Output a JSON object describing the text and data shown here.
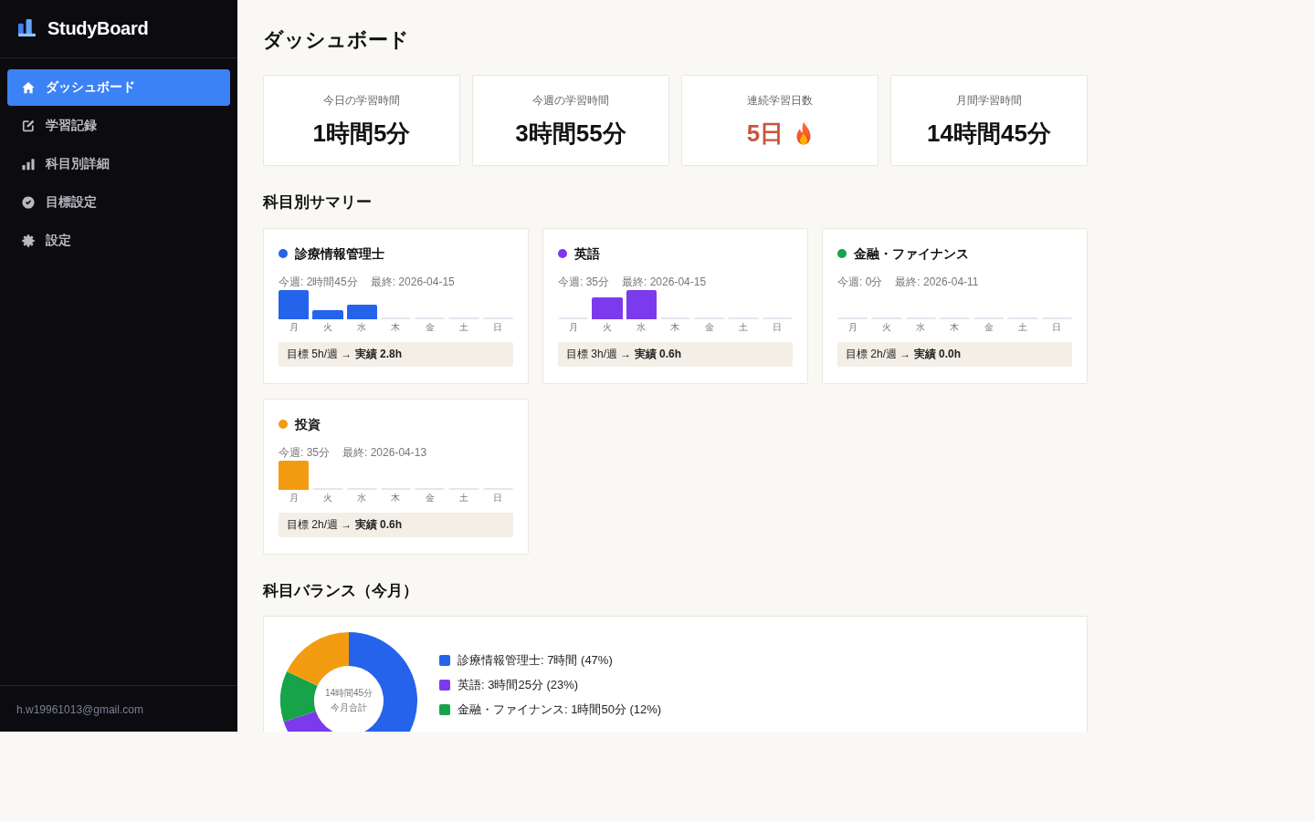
{
  "sidebar": {
    "app_name": "StudyBoard",
    "items": [
      {
        "label": "ダッシュボード",
        "selected": true
      },
      {
        "label": "学習記録",
        "selected": false
      },
      {
        "label": "科目別詳細",
        "selected": false
      },
      {
        "label": "目標設定",
        "selected": false
      },
      {
        "label": "設定",
        "selected": false
      }
    ],
    "user_email": "h.w19961013@gmail.com"
  },
  "page_title": "ダッシュボード",
  "stats": [
    {
      "label": "今日の学習時間",
      "value": "1時間5分",
      "kind": "time"
    },
    {
      "label": "今週の学習時間",
      "value": "3時間55分",
      "kind": "time"
    },
    {
      "label": "連続学習日数",
      "value": "5日",
      "kind": "streak"
    },
    {
      "label": "月間学習時間",
      "value": "14時間45分",
      "kind": "time"
    }
  ],
  "subject_summary": {
    "title": "科目別サマリー",
    "subjects": [
      {
        "name": "診療情報管理士",
        "color": "#2563eb",
        "week": "今週: 2時間45分",
        "last": "最終: 2026-04-15",
        "days": [
          "月",
          "火",
          "水",
          "木",
          "金",
          "土",
          "日"
        ],
        "goal": "目標 5h/週 → **実績 2.8h**"
      },
      {
        "name": "英語",
        "color": "#7c3aed",
        "week": "今週: 35分",
        "last": "最終: 2026-04-15",
        "days": [
          "月",
          "火",
          "水",
          "木",
          "金",
          "土",
          "日"
        ],
        "goal": "目標 3h/週 → **実績 0.6h**"
      },
      {
        "name": "金融・ファイナンス",
        "color": "#16a34a",
        "week": "今週: 0分",
        "last": "最終: 2026-04-11",
        "days": [
          "月",
          "火",
          "水",
          "木",
          "金",
          "土",
          "日"
        ],
        "goal": "目標 2h/週 → **実績 0.0h**"
      },
      {
        "name": "投資",
        "color": "#f39c12",
        "week": "今週: 35分",
        "last": "最終: 2026-04-13",
        "days": [
          "月",
          "火",
          "水",
          "木",
          "金",
          "土",
          "日"
        ],
        "goal": "目標 2h/週 → **実績 0.6h**"
      }
    ]
  },
  "balance": {
    "title": "科目バランス（今月）",
    "chart_data": {
      "type": "donut",
      "values": [
        47,
        23,
        12,
        18
      ]
    },
    "center_value": "14時間45分",
    "center_label": "今月合計",
    "legend": [
      {
        "label": "診療情報管理士: 7時間 (47%)",
        "color": "#2563eb"
      },
      {
        "label": "英語: 3時間25分 (23%)",
        "color": "#7c3aed"
      },
      {
        "label": "金融・ファイナンス: 1時間50分 (12%)",
        "color": "#16a34a"
      }
    ]
  }
}
